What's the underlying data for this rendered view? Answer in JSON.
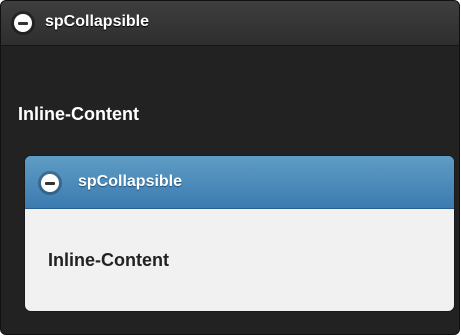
{
  "outer_collapsible": {
    "title": "spCollapsible",
    "content": "Inline-Content",
    "icon": "minus-circle-icon"
  },
  "inner_collapsible": {
    "title": "spCollapsible",
    "content": "Inline-Content",
    "icon": "minus-circle-icon",
    "header_color": "#4a8bbf"
  }
}
